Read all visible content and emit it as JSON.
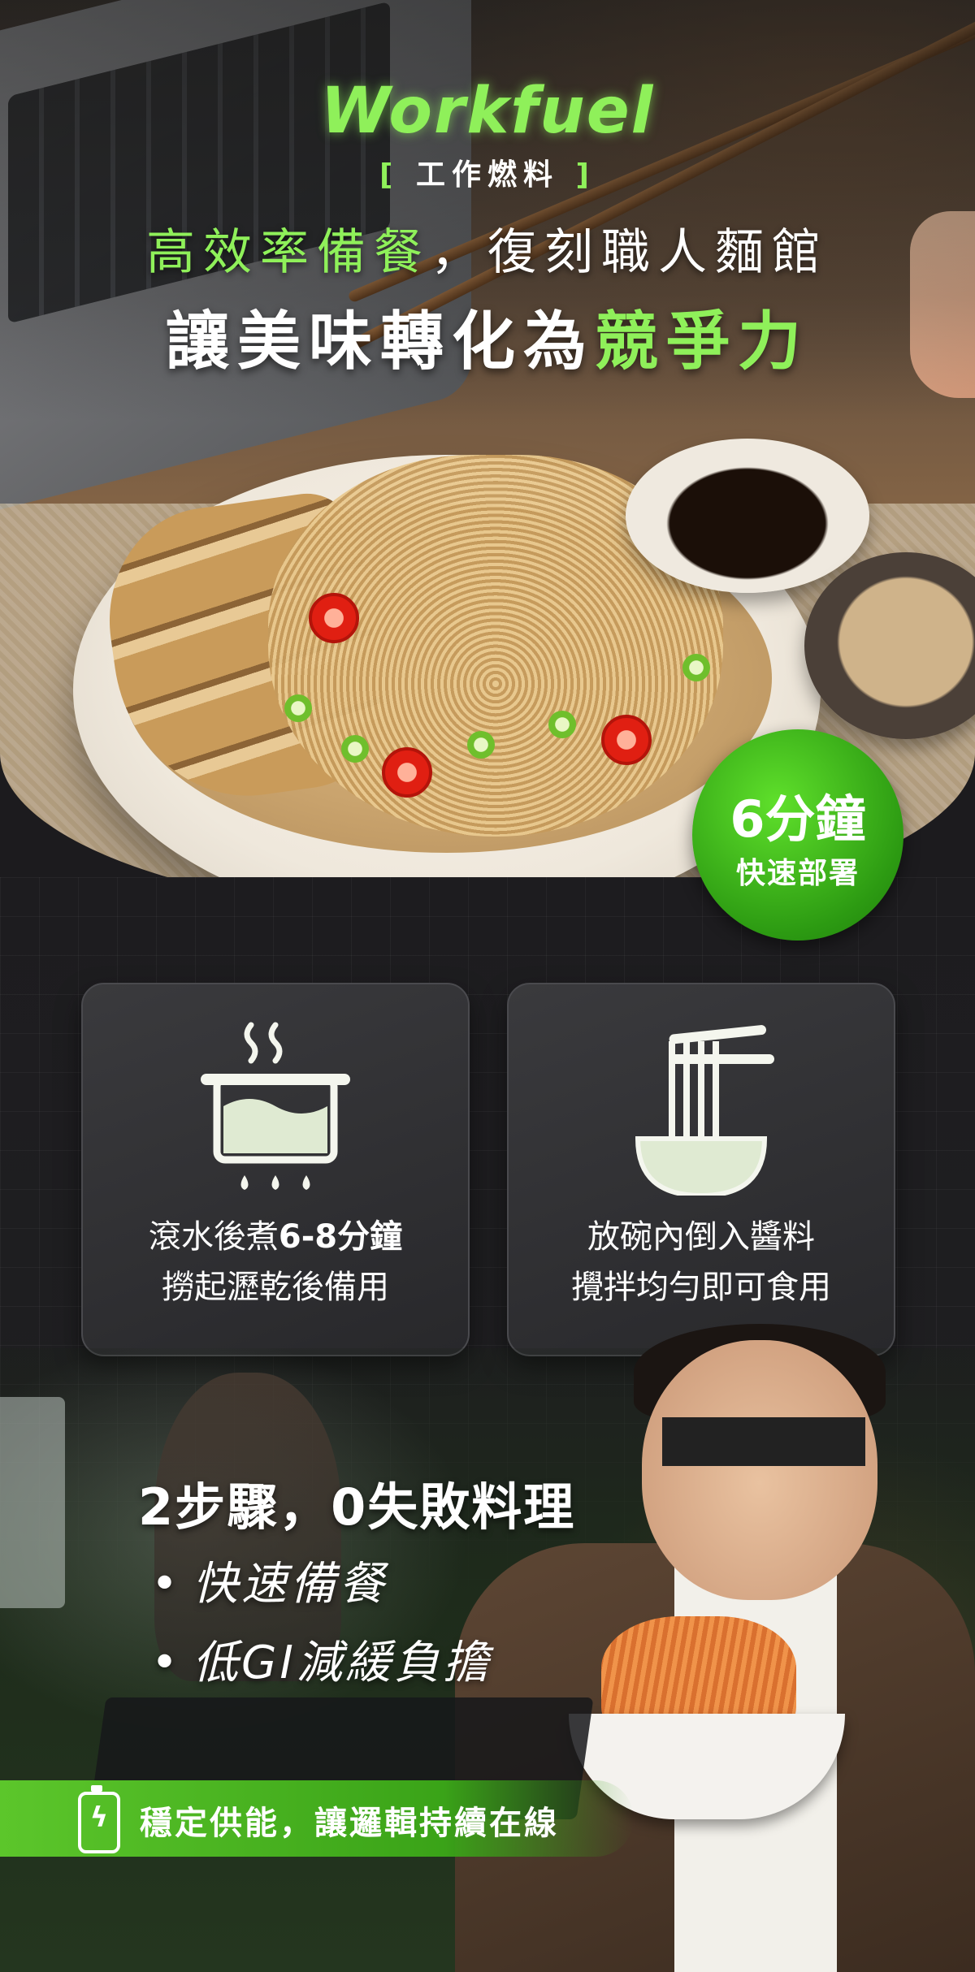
{
  "brand": {
    "logo": "Workfuel",
    "subtitle_bracket_left": "[",
    "subtitle": "工作燃料",
    "subtitle_bracket_right": "]"
  },
  "headline": {
    "line1_green": "高效率備餐",
    "line1_rest": "，復刻職人麵館",
    "line2_white": "讓美味轉化為",
    "line2_green": "競爭力"
  },
  "badge": {
    "time": "6分鐘",
    "label": "快速部署"
  },
  "steps": [
    {
      "icon": "boiling-pot-icon",
      "line1_prefix": "滾水後煮",
      "line1_strong": "6-8分鐘",
      "line2": "撈起瀝乾後備用"
    },
    {
      "icon": "noodle-bowl-icon",
      "line1": "放碗內倒入醬料",
      "line2": "攪拌均勻即可食用"
    }
  ],
  "summary": {
    "title": "2步驟，0失敗料理",
    "bullets": [
      "快速備餐",
      "低GI減緩負擔"
    ]
  },
  "banner": {
    "icon": "battery-bolt-icon",
    "icon_glyph": "ϟ",
    "text": "穩定供能，讓邏輯持續在線"
  },
  "colors": {
    "accent_green": "#8ff05a",
    "badge_green": "#3aa318",
    "card_bg": "#2f2f32"
  }
}
